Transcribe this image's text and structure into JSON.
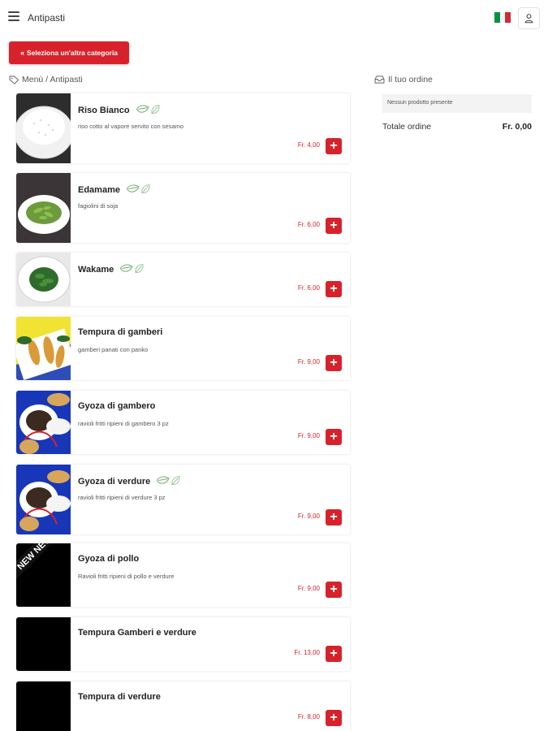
{
  "header": {
    "title": "Antipasti",
    "menu_icon": "hamburger-menu-icon",
    "flag_icon": "italian-flag-icon",
    "flag_colors": [
      "#009246",
      "#ffffff",
      "#ce2b37"
    ],
    "user_icon": "user-icon"
  },
  "back_button": {
    "label": "Seleziona un'altra categoria",
    "icon": "double-chevron-left-icon"
  },
  "breadcrumb": {
    "icon": "tag-icon",
    "text": "Menù / Antipasti"
  },
  "colors": {
    "accent": "#d8222b",
    "leaf": "#6fae6a"
  },
  "products": [
    {
      "name": "Riso Bianco",
      "description": "riso cotto al vapore servito con sesamo",
      "price": "Fr. 4,00",
      "vegan": true,
      "image": "white-rice-bowl"
    },
    {
      "name": "Edamame",
      "description": "fagiolini di soja",
      "price": "Fr. 6,00",
      "vegan": true,
      "image": "edamame-bowl"
    },
    {
      "name": "Wakame",
      "description": "",
      "price": "Fr. 6,00",
      "vegan": true,
      "image": "wakame-seaweed-bowl"
    },
    {
      "name": "Tempura di gamberi",
      "description": "gamberi panati con panko",
      "price": "Fr. 9,00",
      "vegan": false,
      "image": "shrimp-tempura"
    },
    {
      "name": "Gyoza di gambero",
      "description": "ravioli fritti ripieni di gambero 3 pz",
      "price": "Fr. 9,00",
      "vegan": false,
      "image": "gyoza-plate"
    },
    {
      "name": "Gyoza di verdure",
      "description": "ravioli fritti ripieni di verdure 3 pz",
      "price": "Fr. 9,00",
      "vegan": true,
      "image": "gyoza-plate"
    },
    {
      "name": "Gyoza di pollo",
      "description": "Ravioli fritti ripieni di pollo e verdure",
      "price": "Fr. 9,00",
      "vegan": false,
      "image": "new-badge-black",
      "badge": "NEW NEW"
    },
    {
      "name": "Tempura Gamberi e verdure",
      "description": "",
      "price": "Fr. 13,00",
      "vegan": false,
      "image": "black-placeholder"
    },
    {
      "name": "Tempura di verdure",
      "description": "",
      "price": "Fr. 8,00",
      "vegan": false,
      "image": "black-placeholder"
    }
  ],
  "order": {
    "title": "Il tuo ordine",
    "icon": "tray-icon",
    "empty_text": "Nessun prodotto presente",
    "total_label": "Totale ordine",
    "total_value": "Fr. 0,00"
  }
}
